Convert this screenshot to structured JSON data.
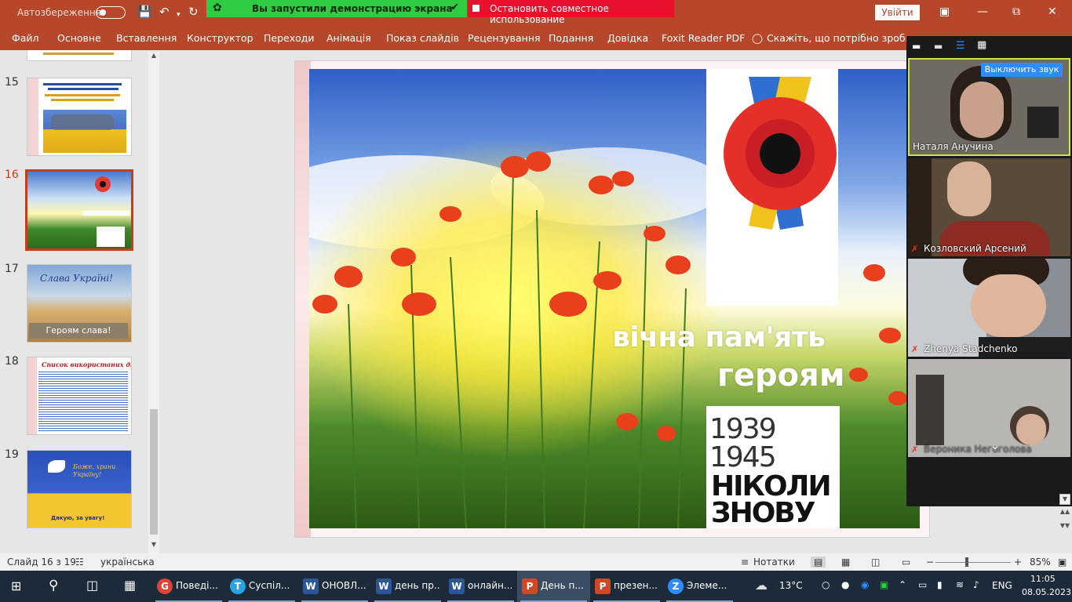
{
  "titlebar": {
    "autosave": "Автозбереження",
    "signin": "Увійти",
    "share_banner": "Вы запустили демонстрацию экрана",
    "stop_share": "Остановить совместное использование"
  },
  "menu": [
    "Файл",
    "Основне",
    "Вставлення",
    "Конструктор",
    "Переходи",
    "Анімація",
    "Показ слайдів",
    "Рецензування",
    "Подання",
    "Довідка",
    "Foxit Reader PDF",
    "Скажіть, що потрібно зробити"
  ],
  "thumbs": {
    "numbers": [
      "15",
      "16",
      "17",
      "18",
      "19"
    ],
    "t17_title": "Слава Україні!",
    "t17_sub": "Героям слава!",
    "t18_title": "Список використаних джерел:",
    "t19_text": "Дякую, за увагу!",
    "t19_title": "Боже, храни Україну!"
  },
  "slide": {
    "line1": "вічна пам'ять",
    "line2": "героям",
    "year1": "1939",
    "year2": "1945",
    "never1": "НІКОЛИ",
    "never2": "ЗНОВУ"
  },
  "zoom": {
    "mute_btn": "Выключить звук",
    "participants": [
      "Наталя Анучина",
      "Козловский Арсений",
      "Zhenya Stadchenko",
      "Вероника Негоголова"
    ]
  },
  "status": {
    "slide": "Слайд 16 з 19",
    "lang": "українська",
    "notes": "Нотатки",
    "zoom": "85%"
  },
  "taskbar": {
    "apps": [
      {
        "label": "Поведі...",
        "color": "#db4437",
        "icon": "G"
      },
      {
        "label": "Суспіл...",
        "color": "#2aa3df",
        "icon": "T"
      },
      {
        "label": "ОНОВЛ...",
        "color": "#2b579a",
        "icon": "W"
      },
      {
        "label": "день пр...",
        "color": "#2b579a",
        "icon": "W"
      },
      {
        "label": "онлайн...",
        "color": "#2b579a",
        "icon": "W"
      },
      {
        "label": "День п...",
        "color": "#d24726",
        "icon": "P"
      },
      {
        "label": "презен...",
        "color": "#d24726",
        "icon": "P"
      },
      {
        "label": "Элеме...",
        "color": "#2d8cff",
        "icon": "Z"
      }
    ],
    "temp": "13°C",
    "lang": "ENG",
    "time": "11:05",
    "date": "08.05.2023"
  },
  "colors": {
    "accent": "#b7472a",
    "share_green": "#2ecc40",
    "stop_red": "#e8102b",
    "selected_border": "#c43e1c"
  }
}
